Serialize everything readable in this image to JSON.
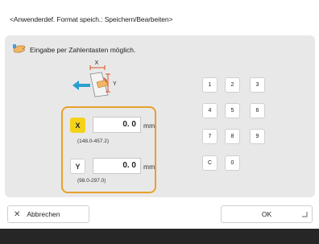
{
  "title": "<Anwenderdef. Format speich.: Speichern/Bearbeiten>",
  "hint": {
    "text": "Eingabe per Zahlentasten möglich.",
    "icon": "hand-pointer-icon"
  },
  "diagram": {
    "x_label": "X",
    "y_label": "Y"
  },
  "x_field": {
    "axis": "X",
    "value": "0. 0",
    "unit": "mm",
    "range": "(148.0-457.2)",
    "selected": true
  },
  "y_field": {
    "axis": "Y",
    "value": "0. 0",
    "unit": "mm",
    "range": "(98.0-297.0)",
    "selected": false
  },
  "keypad": [
    "1",
    "2",
    "3",
    "4",
    "5",
    "6",
    "7",
    "8",
    "9",
    "C",
    "0"
  ],
  "buttons": {
    "cancel": "Abbrechen",
    "ok": "OK"
  },
  "colors": {
    "highlight": "#e8a02a",
    "active_axis": "#f5d21a",
    "panel": "#e8e8e8"
  }
}
